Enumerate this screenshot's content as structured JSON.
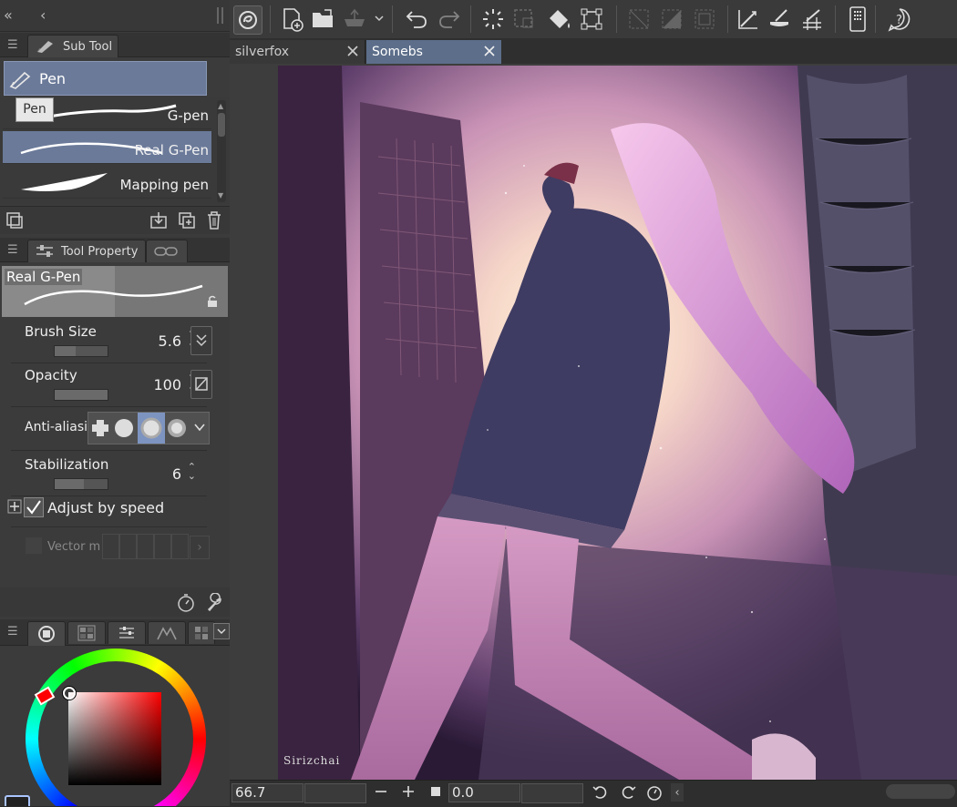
{
  "subtool_panel": {
    "tab_label": "Sub Tool",
    "group_label": "Pen",
    "tooltip": "Pen",
    "items": [
      {
        "label": "G-pen"
      },
      {
        "label": "Real G-Pen"
      },
      {
        "label": "Mapping pen"
      }
    ]
  },
  "tool_property": {
    "tab_label": "Tool Property",
    "preview_label": "Real G-Pen",
    "brush_size": {
      "label": "Brush Size",
      "value": "5.6"
    },
    "opacity": {
      "label": "Opacity",
      "value": "100"
    },
    "anti_aliasing": {
      "label": "Anti-aliasin"
    },
    "stabilization": {
      "label": "Stabilization",
      "value": "6"
    },
    "adjust_by_speed": {
      "label": "Adjust by speed",
      "checked": true
    },
    "vector_magnet": {
      "label": "Vector ma"
    }
  },
  "documents": {
    "tabs": [
      {
        "label": "silverfox",
        "active": false
      },
      {
        "label": "Somebs",
        "active": true
      }
    ]
  },
  "artwork": {
    "signature": "Sirizchai"
  },
  "statusbar": {
    "zoom": "66.7",
    "rotation": "0.0"
  },
  "colors": {
    "panel_bg": "#3b3b3b",
    "selected_row": "#6b7a99",
    "active_tab": "#5c6e8a",
    "accent": "#4a6aa6"
  }
}
